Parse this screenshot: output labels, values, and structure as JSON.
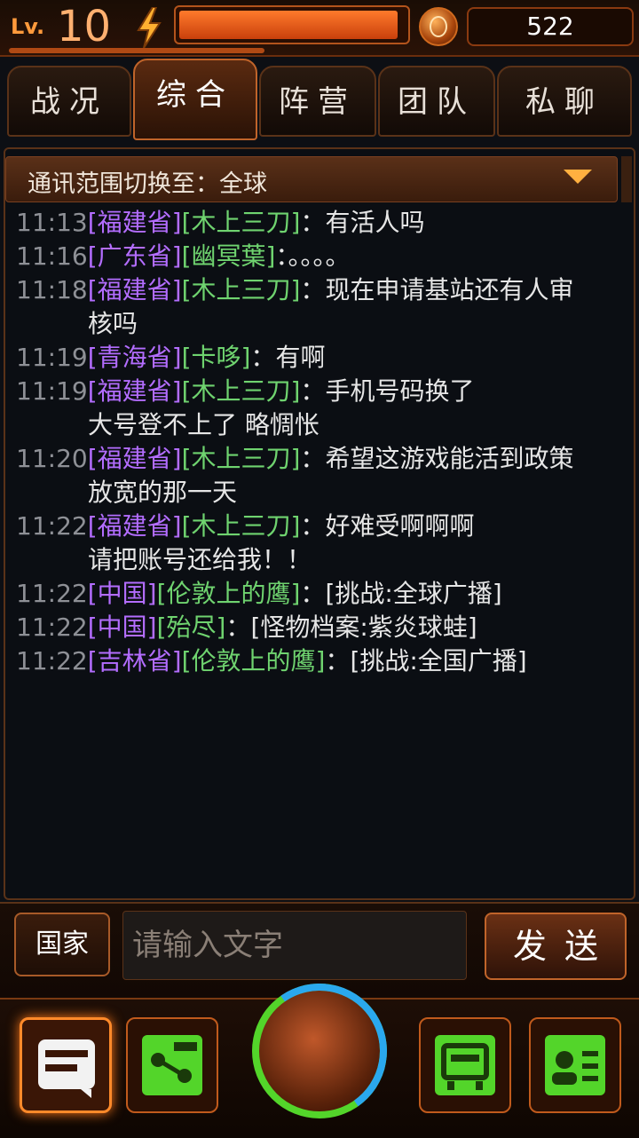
{
  "status": {
    "level_label": "Lv.",
    "level_value": "10",
    "energy_fraction": 0.97,
    "xp_fraction": 0.4,
    "currency_value": "522"
  },
  "tabs": [
    {
      "label": "战况",
      "active": false
    },
    {
      "label": "综合",
      "active": true
    },
    {
      "label": "阵营",
      "active": false
    },
    {
      "label": "团队",
      "active": false
    },
    {
      "label": "私聊",
      "active": false
    }
  ],
  "scope": {
    "text": "通讯范围切换至：全球"
  },
  "messages": [
    {
      "time": "11:13",
      "region": "[福建省]",
      "user": "[木上三刀]",
      "sep": "：",
      "text": "有活人吗",
      "cont": []
    },
    {
      "time": "11:16",
      "region": "[广东省]",
      "user": "[幽冥葉]",
      "sep": "：",
      "text": "。。。。",
      "cont": []
    },
    {
      "time": "11:18",
      "region": "[福建省]",
      "user": "[木上三刀]",
      "sep": "：",
      "text": "现在申请基站还有人审",
      "cont": [
        "核吗"
      ]
    },
    {
      "time": "11:19",
      "region": "[青海省]",
      "user": "[卡哆]",
      "sep": "：",
      "text": "有啊",
      "cont": []
    },
    {
      "time": "11:19",
      "region": "[福建省]",
      "user": "[木上三刀]",
      "sep": "：",
      "text": "手机号码换了",
      "cont": [
        "大号登不上了 略惆怅"
      ]
    },
    {
      "time": "11:20",
      "region": "[福建省]",
      "user": "[木上三刀]",
      "sep": "：",
      "text": "希望这游戏能活到政策",
      "cont": [
        "放宽的那一天"
      ]
    },
    {
      "time": "11:22",
      "region": "[福建省]",
      "user": "[木上三刀]",
      "sep": "：",
      "text": "好难受啊啊啊",
      "cont": [
        "请把账号还给我！！"
      ]
    },
    {
      "time": "11:22",
      "region": "[中国]",
      "user": "[伦敦上的鹰]",
      "sep": "：",
      "text": "[挑战:全球广播]",
      "cont": []
    },
    {
      "time": "11:22",
      "region": "[中国]",
      "user": "[殆尽]",
      "sep": "：",
      "text": "[怪物档案:紫炎球蛙]",
      "cont": []
    },
    {
      "time": "11:22",
      "region": "[吉林省]",
      "user": "[伦敦上的鹰]",
      "sep": "：",
      "text": "[挑战:全国广播]",
      "cont": []
    }
  ],
  "input": {
    "country_label": "国家",
    "placeholder": "请输入文字",
    "send_label": "发送"
  },
  "nav": {
    "items": [
      "chat-icon",
      "route-icon",
      "device-icon",
      "profile-icon"
    ],
    "center": "globe-icon"
  },
  "colors": {
    "accent": "#c0642a",
    "time": "#8e9096",
    "region": "#b36dff",
    "user": "#6fd36f",
    "nav_green": "#53d52a"
  }
}
